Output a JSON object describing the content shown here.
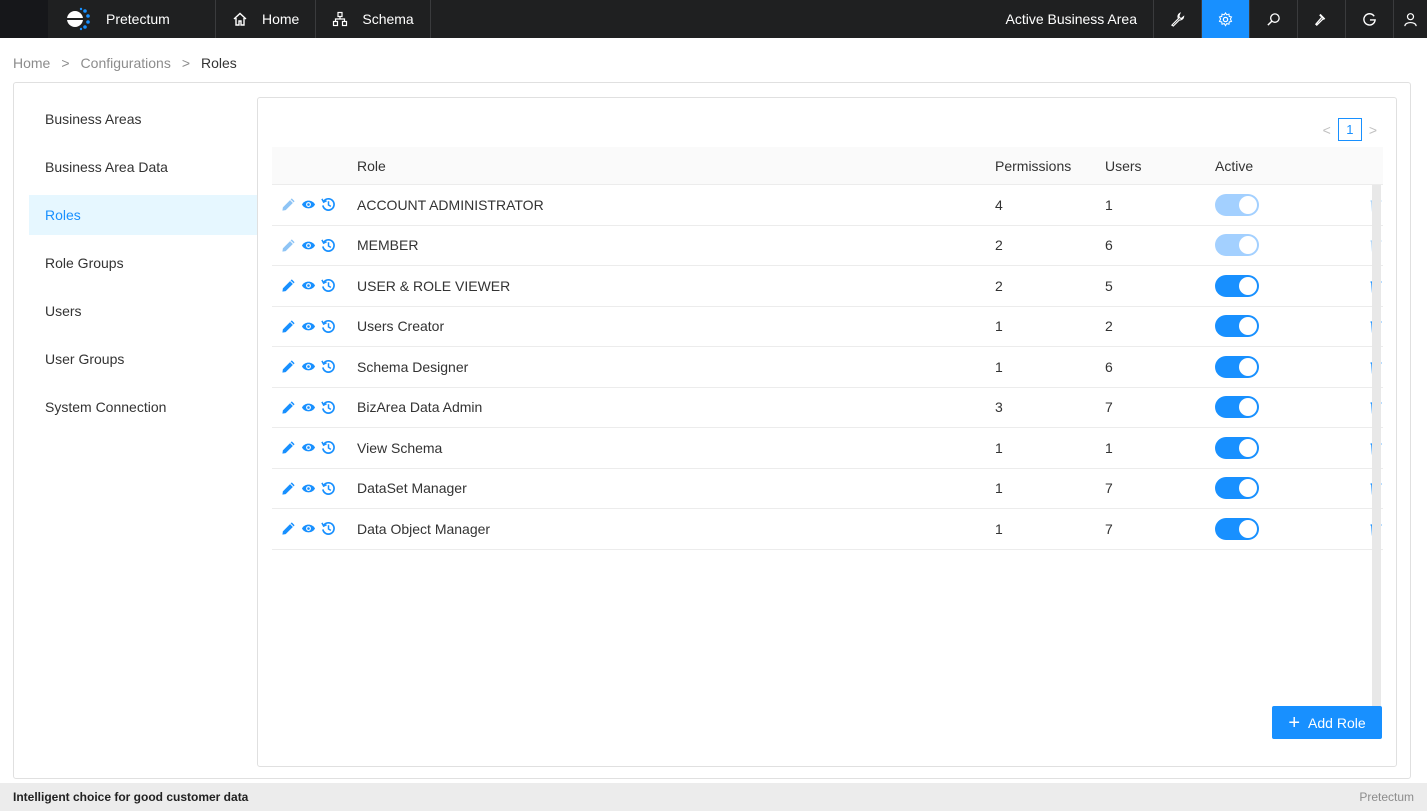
{
  "header": {
    "brand": "Pretectum",
    "nav": [
      {
        "label": "Home",
        "icon": "home-icon"
      },
      {
        "label": "Schema",
        "icon": "schema-icon"
      }
    ],
    "active_area": "Active Business Area",
    "icons": [
      "wrench-icon",
      "settings-icon",
      "search-icon",
      "hammer-icon",
      "google-icon",
      "user-icon"
    ],
    "active_icon": "settings-icon",
    "accent": "#1890ff",
    "bar_color": "#1f2021"
  },
  "breadcrumb": {
    "items": [
      "Home",
      "Configurations",
      "Roles"
    ],
    "separator": ">"
  },
  "sidebar": {
    "items": [
      {
        "label": "Business Areas"
      },
      {
        "label": "Business Area Data"
      },
      {
        "label": "Roles"
      },
      {
        "label": "Role Groups"
      },
      {
        "label": "Users"
      },
      {
        "label": "User Groups"
      },
      {
        "label": "System Connection"
      }
    ],
    "selected": "Roles"
  },
  "pagination": {
    "current": "1",
    "prev": "<",
    "next": ">"
  },
  "table": {
    "columns": {
      "role": "Role",
      "permissions": "Permissions",
      "users": "Users",
      "active": "Active"
    },
    "rows": [
      {
        "role": "ACCOUNT ADMINISTRATOR",
        "permissions": "4",
        "users": "1",
        "active": true,
        "locked": true
      },
      {
        "role": "MEMBER",
        "permissions": "2",
        "users": "6",
        "active": true,
        "locked": true
      },
      {
        "role": "USER & ROLE VIEWER",
        "permissions": "2",
        "users": "5",
        "active": true,
        "locked": false
      },
      {
        "role": "Users Creator",
        "permissions": "1",
        "users": "2",
        "active": true,
        "locked": false
      },
      {
        "role": "Schema Designer",
        "permissions": "1",
        "users": "6",
        "active": true,
        "locked": false
      },
      {
        "role": "BizArea Data Admin",
        "permissions": "3",
        "users": "7",
        "active": true,
        "locked": false
      },
      {
        "role": "View Schema",
        "permissions": "1",
        "users": "1",
        "active": true,
        "locked": false
      },
      {
        "role": "DataSet Manager",
        "permissions": "1",
        "users": "7",
        "active": true,
        "locked": false
      },
      {
        "role": "Data Object Manager",
        "permissions": "1",
        "users": "7",
        "active": true,
        "locked": false
      }
    ]
  },
  "add_button": {
    "label": "Add Role",
    "icon": "plus-icon"
  },
  "footer": {
    "tagline": "Intelligent choice for good customer data",
    "brand": "Pretectum"
  }
}
